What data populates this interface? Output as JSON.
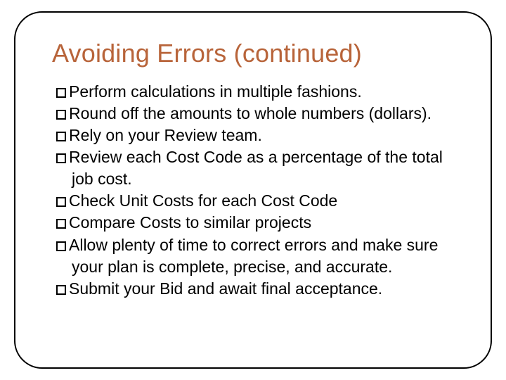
{
  "slide": {
    "title": "Avoiding Errors (continued)",
    "items": [
      "Perform calculations in multiple fashions.",
      "Round off the amounts to whole numbers (dollars).",
      "Rely on your Review team.",
      "Review each Cost Code as a percentage of the total job cost.",
      "Check Unit Costs for each Cost Code",
      "Compare Costs to similar projects",
      "Allow plenty of time to correct errors and make sure your plan is complete, precise, and accurate.",
      "Submit your Bid and await final acceptance."
    ]
  }
}
